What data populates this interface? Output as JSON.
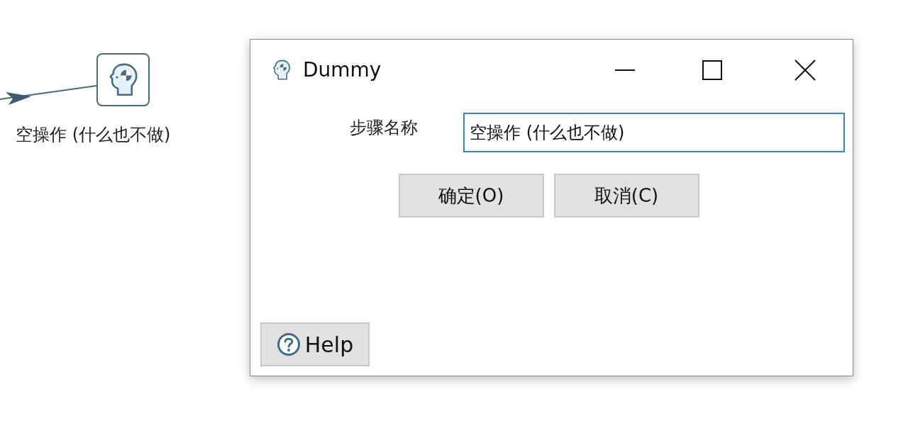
{
  "canvas": {
    "step": {
      "label": "空操作 (什么也不做)"
    }
  },
  "dialog": {
    "title": "Dummy",
    "field": {
      "label": "步骤名称",
      "value": "空操作 (什么也不做)"
    },
    "buttons": [
      "确定(O)",
      "取消(C)"
    ],
    "help": "Help"
  }
}
